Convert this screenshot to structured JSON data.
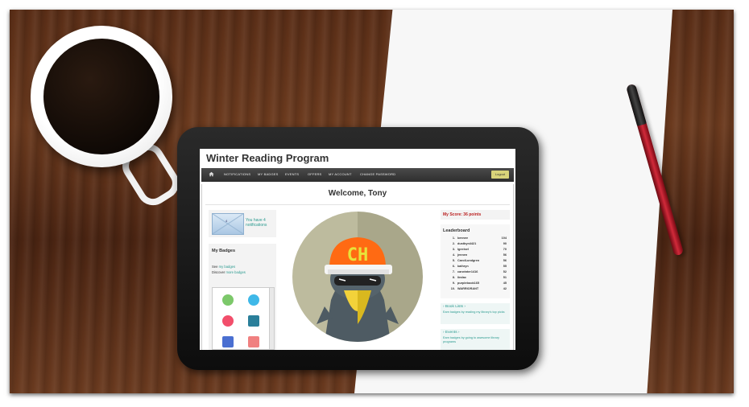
{
  "site": {
    "title": "Winter Reading Program"
  },
  "nav": {
    "items": [
      "NOTIFICATIONS",
      "MY BADGES",
      "EVENTS",
      "OFFERS",
      "MY ACCOUNT",
      "CHANGE PASSWORD"
    ],
    "logout_label": "Logout"
  },
  "main": {
    "welcome": "Welcome, Tony"
  },
  "notifications": {
    "count": "4",
    "message": "You have 4 notifications"
  },
  "badges": {
    "title": "My Badges",
    "see_prefix": "See ",
    "see_link": "my badges",
    "discover_prefix": "Discover ",
    "discover_link": "more badges"
  },
  "hero": {
    "cap_text": "CH",
    "cap_color": "#ff6a13"
  },
  "score": {
    "label": "My Score: 36 points"
  },
  "leaderboard": {
    "title": "Leaderboard",
    "rows": [
      {
        "rank": "1.",
        "name": "kennee",
        "points": "104"
      },
      {
        "rank": "2.",
        "name": "dustbyn4421",
        "points": "90"
      },
      {
        "rank": "3.",
        "name": "lgeeisel",
        "points": "70"
      },
      {
        "rank": "4.",
        "name": "jennen",
        "points": "56"
      },
      {
        "rank": "5.",
        "name": "CarolLundgren",
        "points": "56"
      },
      {
        "rank": "6.",
        "name": "kathryn",
        "points": "55"
      },
      {
        "rank": "7.",
        "name": "carwinter1416",
        "points": "52"
      },
      {
        "rank": "8.",
        "name": "lindac",
        "points": "51"
      },
      {
        "rank": "9.",
        "name": "purplebook165",
        "points": "45"
      },
      {
        "rank": "10.",
        "name": "WARRIORANT",
        "points": "42"
      }
    ]
  },
  "book_lists": {
    "title": "› Book Lists ›",
    "desc": "Earn badges by reading my library's top picks"
  },
  "events": {
    "title": "› Events ›",
    "desc": "Earn badges by going to awesome library programs"
  },
  "colors": {
    "accent": "#2a9a8f",
    "score_red": "#bb2222",
    "nav_dark": "#333333"
  }
}
